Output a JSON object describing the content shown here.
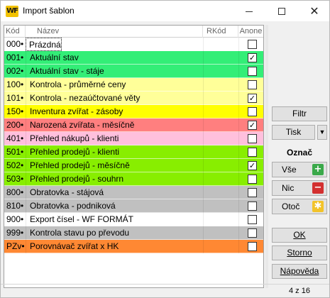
{
  "window": {
    "logo_text": "WF",
    "title": "Import šablon",
    "icons": {
      "minimize": "minimize-icon",
      "maximize": "maximize-icon",
      "close": "close-icon"
    }
  },
  "table": {
    "columns": {
      "kod": "Kód",
      "nazev": "Název",
      "rkod": "RKód",
      "anone": "Anone"
    },
    "rows": [
      {
        "kod": "000•",
        "nazev": "Prázdná",
        "rkod": "",
        "checked": false,
        "color": "#ffffff"
      },
      {
        "kod": "001•",
        "nazev": "Aktuální stav",
        "rkod": "",
        "checked": true,
        "color": "#33ee77"
      },
      {
        "kod": "002•",
        "nazev": "Aktuální stav - stáje",
        "rkod": "",
        "checked": false,
        "color": "#33ee77"
      },
      {
        "kod": "100•",
        "nazev": "Kontrola - průměrné ceny",
        "rkod": "",
        "checked": false,
        "color": "#ffff99"
      },
      {
        "kod": "101•",
        "nazev": "Kontrola - nezaúčtované věty",
        "rkod": "",
        "checked": true,
        "color": "#ffff99"
      },
      {
        "kod": "150•",
        "nazev": "Inventura zvířat - zásoby",
        "rkod": "",
        "checked": false,
        "color": "#ffff00"
      },
      {
        "kod": "200•",
        "nazev": "Narozená zvířata - měsíčně",
        "rkod": "",
        "checked": true,
        "color": "#ff7f7f"
      },
      {
        "kod": "401•",
        "nazev": "Přehled nákupů - klienti",
        "rkod": "",
        "checked": false,
        "color": "#ffc0dd"
      },
      {
        "kod": "501•",
        "nazev": "Přehled prodejů - klienti",
        "rkod": "",
        "checked": false,
        "color": "#88ee00"
      },
      {
        "kod": "502•",
        "nazev": "Přehled prodejů - měsíčně",
        "rkod": "",
        "checked": true,
        "color": "#88ee00"
      },
      {
        "kod": "503•",
        "nazev": "Přehled prodejů - souhrn",
        "rkod": "",
        "checked": false,
        "color": "#88ee00"
      },
      {
        "kod": "800•",
        "nazev": "Obratovka - stájová",
        "rkod": "",
        "checked": false,
        "color": "#c0c0c0"
      },
      {
        "kod": "810•",
        "nazev": "Obratovka - podniková",
        "rkod": "",
        "checked": false,
        "color": "#c0c0c0"
      },
      {
        "kod": "900•",
        "nazev": "Export čísel - WF FORMÁT",
        "rkod": "",
        "checked": false,
        "color": "#ffffff"
      },
      {
        "kod": "999•",
        "nazev": "Kontrola stavu po převodu",
        "rkod": "",
        "checked": false,
        "color": "#c0c0c0"
      },
      {
        "kod": "PZv•",
        "nazev": "Porovnávač zvířat x HK",
        "rkod": "",
        "checked": false,
        "color": "#ff8833"
      }
    ],
    "selected_row_index": 0,
    "check_glyph": "✓"
  },
  "side": {
    "filtr": "Filtr",
    "tisk": "Tisk",
    "tisk_arrow": "▼",
    "oznac_heading": "Označ",
    "vse": "Vše",
    "nic": "Nic",
    "otoc": "Otoč",
    "vse_icon_glyph": "+",
    "nic_icon_glyph": "−",
    "otoc_icon_glyph": "✱",
    "ok": "OK",
    "storno": "Storno",
    "napoveda": "Nápověda"
  },
  "status": {
    "count": "4 z 16"
  }
}
